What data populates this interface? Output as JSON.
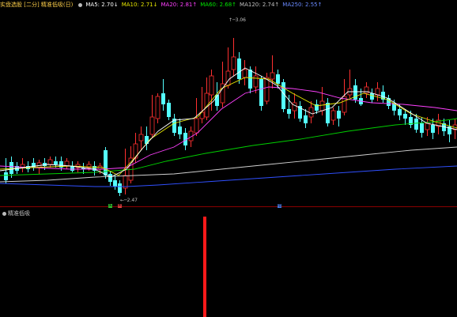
{
  "header": {
    "title": "实盘选股 [二分] 精准低吸(日)",
    "indicators": [
      {
        "label": "MA5: 2.70↓",
        "color": "#ffffff"
      },
      {
        "label": "MA10: 2.71↓",
        "color": "#e6e600"
      },
      {
        "label": "MA20: 2.81↑",
        "color": "#ff40ff"
      },
      {
        "label": "MA60: 2.68↑",
        "color": "#00e600"
      },
      {
        "label": "MA120: 2.74↑",
        "color": "#c0c0c0"
      },
      {
        "label": "MA250: 2.55↑",
        "color": "#4a6aff"
      }
    ]
  },
  "annotations": {
    "high_price": "3.06",
    "low_price": "2.47"
  },
  "signals": [
    {
      "label": "买",
      "color": "#30c030"
    },
    {
      "label": "卖",
      "color": "#e04040"
    },
    {
      "label": "增",
      "color": "#4a7adf"
    }
  ],
  "sub_panel": {
    "title": "精准低吸",
    "bar_color": "#ff1a1a"
  },
  "colors": {
    "up": "#ff3030",
    "down": "#54ffff",
    "ma5": "#ffffff",
    "ma10": "#e6e600",
    "ma20": "#ff40ff",
    "ma60": "#00d000",
    "ma120": "#d0d0d0",
    "ma250": "#3050ff"
  }
}
